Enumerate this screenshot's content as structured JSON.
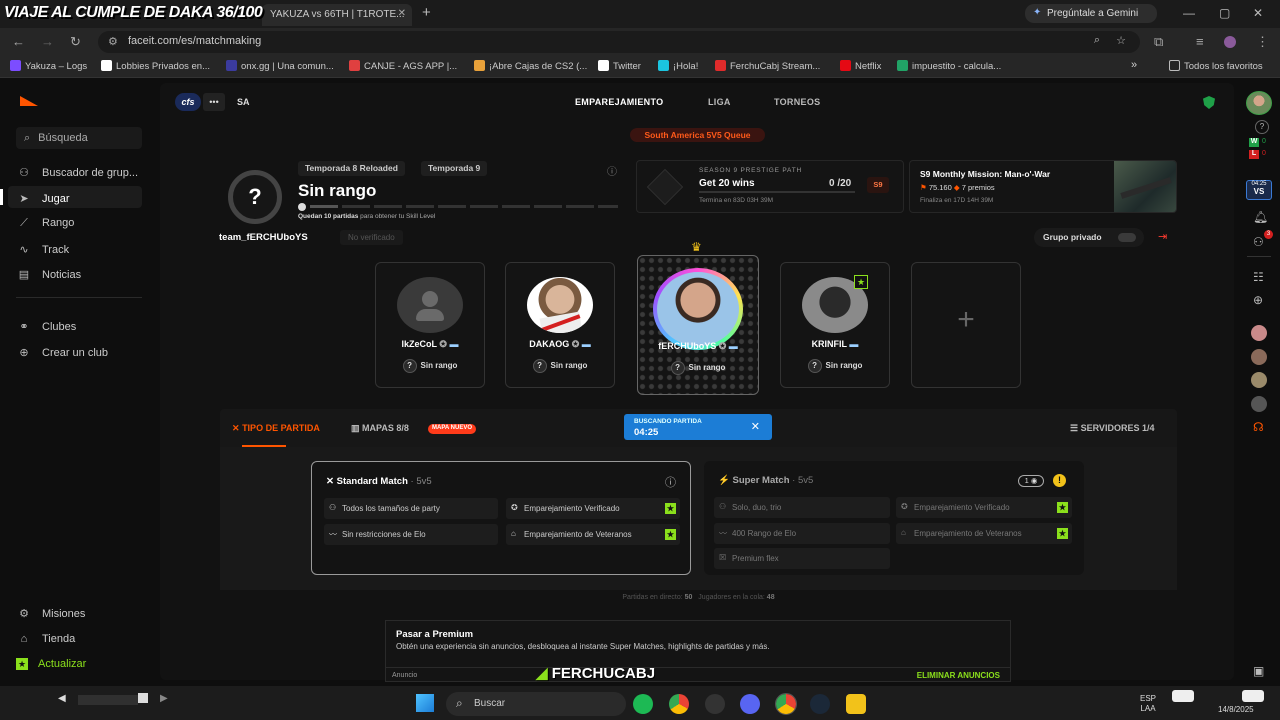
{
  "browser": {
    "overlay_title": "VIAJE AL CUMPLE DE DAKA 36/100",
    "tabs": [
      "YAKUZA vs 66TH | T1ROTE..."
    ],
    "new_tab": "+",
    "gemini": "Pregúntale a Gemini",
    "url": "faceit.com/es/matchmaking",
    "bookmarks": [
      "Yakuza – Logs",
      "Lobbies Privados en...",
      "onx.gg | Una comun...",
      "CANJE - AGS APP |...",
      "¡Abre Cajas de CS2 (...",
      "Twitter",
      "¡Hola!",
      "FerchuCabj Stream...",
      "Netflix",
      "impuestito - calcula..."
    ],
    "bookmarks_all": "Todos los favoritos",
    "bookmark_colors": [
      "#7c4dff",
      "#ffffff",
      "#3b3b9e",
      "#e04040",
      "#e8a13a",
      "#ffffff",
      "#1bc5e0",
      "#e02b2b",
      "#e50914",
      "#21a366"
    ]
  },
  "sidebar": {
    "search": "Búsqueda",
    "items": [
      {
        "label": "Buscador de grup...",
        "icon": "users-icon"
      },
      {
        "label": "Jugar",
        "icon": "play-icon"
      },
      {
        "label": "Rango",
        "icon": "rank-icon"
      },
      {
        "label": "Track",
        "icon": "track-icon"
      },
      {
        "label": "Noticias",
        "icon": "news-icon"
      }
    ],
    "clubs": "Clubes",
    "create_club": "Crear un club",
    "missions": "Misiones",
    "store": "Tienda",
    "upgrade": "Actualizar"
  },
  "header": {
    "team_tag": "cfs",
    "dots": "•••",
    "region": "SA",
    "nav": [
      "EMPAREJAMIENTO",
      "LIGA",
      "TORNEOS"
    ],
    "queue": "South America 5V5 Queue"
  },
  "rank": {
    "season_tags": [
      "Temporada 8 Reloaded",
      "Temporada 9"
    ],
    "title": "Sin rango",
    "subtitle_bold": "Quedan 10 partidas",
    "subtitle_rest": "para obtener tu Skill Level",
    "q": "?"
  },
  "prestige": {
    "label": "SEASON 9 PRESTIGE PATH",
    "goal": "Get 20 wins",
    "progress": "0 /20",
    "ends": "Termina en 83D 03H 39M",
    "badge": "S9",
    "progress_value": 0
  },
  "mission": {
    "title": "S9 Monthly Mission: Man-o'-War",
    "points": "75.160",
    "prizes": "7 premios",
    "ends": "Finaliza en 17D 14H 39M"
  },
  "party": {
    "team_name": "team_fERCHUboYS",
    "verified": "No verificado",
    "private_group": "Grupo privado",
    "members": [
      {
        "name": "lkZeCoL",
        "rank": "Sin rango"
      },
      {
        "name": "DAKAOG",
        "rank": "Sin rango"
      },
      {
        "name": "fERCHUboYS",
        "rank": "Sin rango"
      },
      {
        "name": "KRINFIL",
        "rank": "Sin rango"
      }
    ],
    "add": "+"
  },
  "matchbar": {
    "match_type": "TIPO DE PARTIDA",
    "maps": "MAPAS 8/8",
    "new_map": "MAPA NUEVO",
    "searching": "BUSCANDO PARTIDA",
    "timer": "04:25",
    "servers": "SERVIDORES 1/4"
  },
  "standard": {
    "title": "Standard Match",
    "mode": "· 5v5",
    "features": [
      "Todos los tamaños de party",
      "Emparejamiento Verificado",
      "Sin restricciones de Elo",
      "Emparejamiento de Veteranos"
    ]
  },
  "super": {
    "title": "Super Match",
    "mode": "· 5v5",
    "count": "1",
    "features": [
      "Solo, duo, trio",
      "Emparejamiento Verificado",
      "400 Rango de Elo",
      "Emparejamiento de Veteranos",
      "Premium flex"
    ]
  },
  "stats": {
    "live_label": "Partidas en directo:",
    "live": "50",
    "queue_label": "Jugadores en la cola:",
    "queue": "48"
  },
  "premium": {
    "title": "Pasar a Premium",
    "desc": "Obtén una experiencia sin anuncios, desbloquea al instante Super Matches, highlights de partidas y más.",
    "ad": "Anuncio",
    "remove": "ELIMINAR ANUNCIOS",
    "watermark": "FERCHUCABJ"
  },
  "rightbar": {
    "notif_badge": "3",
    "vs_time": "04:25",
    "score_w": "0",
    "score_l": "0",
    "badge_q": "?"
  },
  "taskbar": {
    "search": "Buscar",
    "lang1": "ESP",
    "lang2": "LAA",
    "date": "14/8/2025"
  },
  "colors": {
    "accent": "#ff5500",
    "green": "#8be01c",
    "search_blue": "#1c7dd6"
  }
}
